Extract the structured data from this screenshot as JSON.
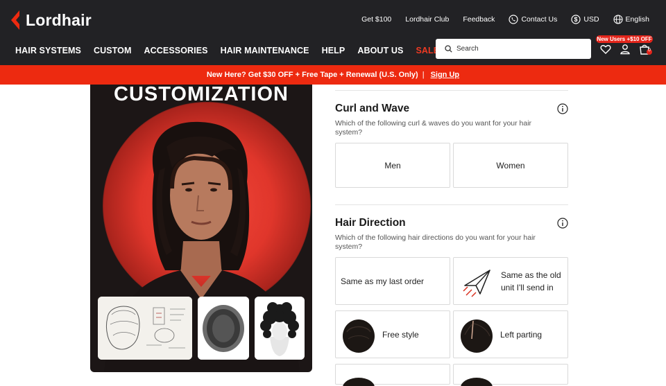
{
  "brand": {
    "name": "Lordhair",
    "accent": "#ed2a10"
  },
  "toplinks": [
    {
      "label": "Get $100",
      "icon": ""
    },
    {
      "label": "Lordhair Club",
      "icon": ""
    },
    {
      "label": "Feedback",
      "icon": ""
    },
    {
      "label": "Contact Us",
      "icon": "phone-icon"
    },
    {
      "label": "USD",
      "icon": "dollar-icon"
    },
    {
      "label": "English",
      "icon": "globe-icon"
    }
  ],
  "nav": {
    "items": [
      "HAIR SYSTEMS",
      "CUSTOM",
      "ACCESSORIES",
      "HAIR MAINTENANCE",
      "HELP",
      "ABOUT US",
      "SALE"
    ]
  },
  "search": {
    "placeholder": "Search"
  },
  "header_icons": {
    "promo": "New Users +$10 OFF",
    "cart_count": "0"
  },
  "banner": {
    "text": "New Here? Get $30 OFF + Free Tape + Renewal (U.S. Only)",
    "separator": "|",
    "link": "Sign Up"
  },
  "hero": {
    "title": "CUSTOMIZATION"
  },
  "curl_section": {
    "title": "Curl and Wave",
    "desc": "Which of the following curl & waves do you want for your hair system?",
    "options": [
      "Men",
      "Women"
    ]
  },
  "direction_section": {
    "title": "Hair Direction",
    "desc": "Which of the following hair directions do you want for your hair system?",
    "options": [
      "Same as my last order",
      "Same as the old unit I'll send in",
      "Free style",
      "Left parting"
    ]
  }
}
